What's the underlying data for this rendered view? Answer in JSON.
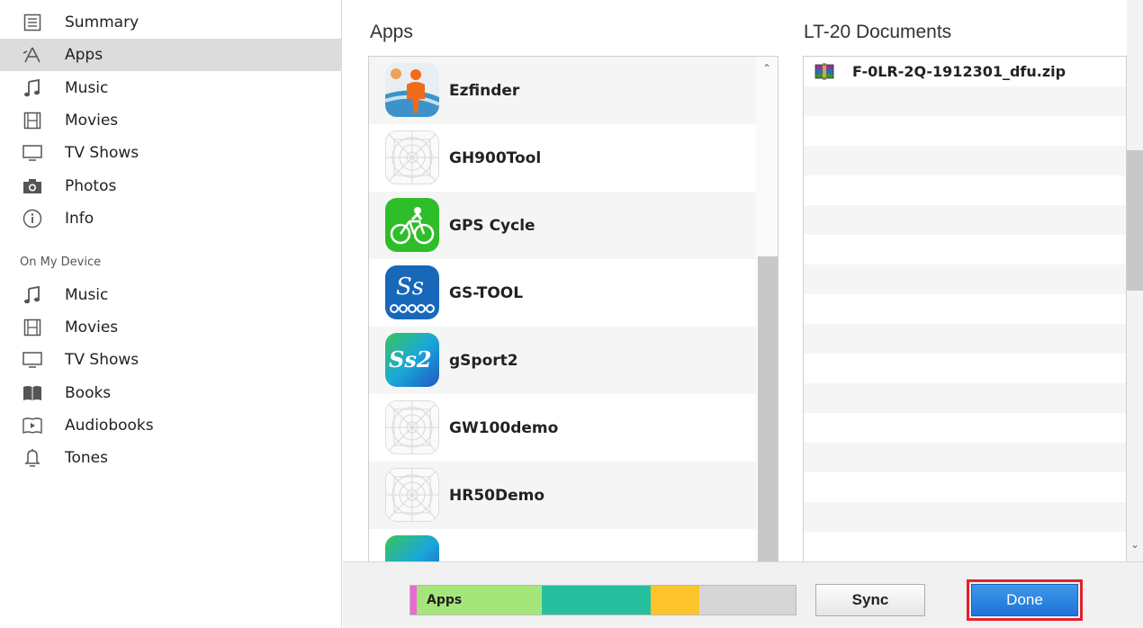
{
  "sidebar": {
    "items": [
      {
        "label": "Summary",
        "icon": "summary-icon"
      },
      {
        "label": "Apps",
        "icon": "apps-icon",
        "selected": true
      },
      {
        "label": "Music",
        "icon": "music-icon"
      },
      {
        "label": "Movies",
        "icon": "movies-icon"
      },
      {
        "label": "TV Shows",
        "icon": "tv-icon"
      },
      {
        "label": "Photos",
        "icon": "camera-icon"
      },
      {
        "label": "Info",
        "icon": "info-icon"
      }
    ],
    "section_title": "On My Device",
    "device_items": [
      {
        "label": "Music",
        "icon": "music-icon"
      },
      {
        "label": "Movies",
        "icon": "movies-icon"
      },
      {
        "label": "TV Shows",
        "icon": "tv-icon"
      },
      {
        "label": "Books",
        "icon": "books-icon"
      },
      {
        "label": "Audiobooks",
        "icon": "audiobook-icon"
      },
      {
        "label": "Tones",
        "icon": "bell-icon"
      }
    ]
  },
  "apps": {
    "title": "Apps",
    "list": [
      {
        "name": "Ezfinder",
        "icon": "ezfinder-app-icon"
      },
      {
        "name": "GH900Tool",
        "icon": "placeholder-app-icon"
      },
      {
        "name": "GPS Cycle",
        "icon": "gps-cycle-app-icon"
      },
      {
        "name": "GS-TOOL",
        "icon": "gs-tool-app-icon"
      },
      {
        "name": "gSport2",
        "icon": "gsport2-app-icon"
      },
      {
        "name": "GW100demo",
        "icon": "placeholder-app-icon"
      },
      {
        "name": "HR50Demo",
        "icon": "placeholder-app-icon"
      },
      {
        "name": "",
        "icon": "partial-app-icon"
      }
    ]
  },
  "documents": {
    "title": "LT-20 Documents",
    "files": [
      {
        "name": "F-0LR-2Q-1912301_dfu.zip",
        "icon": "zip-file-icon"
      }
    ]
  },
  "capacity": {
    "label": "Apps",
    "segments": [
      {
        "name": "other-pink",
        "fraction": 0.016,
        "color": "#e86ad2"
      },
      {
        "name": "apps",
        "fraction": 0.325,
        "color": "#a5e67a"
      },
      {
        "name": "documents",
        "fraction": 0.282,
        "color": "#27c09f"
      },
      {
        "name": "other",
        "fraction": 0.128,
        "color": "#fec42b"
      },
      {
        "name": "free",
        "fraction": 0.249,
        "color": "#d6d6d6"
      }
    ]
  },
  "buttons": {
    "sync_label": "Sync",
    "done_label": "Done"
  }
}
